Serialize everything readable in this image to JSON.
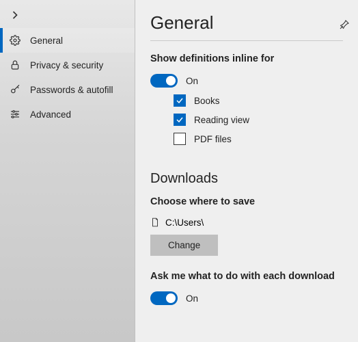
{
  "sidebar": {
    "items": [
      {
        "label": "General",
        "icon": "gear-icon",
        "selected": true
      },
      {
        "label": "Privacy & security",
        "icon": "lock-icon",
        "selected": false
      },
      {
        "label": "Passwords & autofill",
        "icon": "key-icon",
        "selected": false
      },
      {
        "label": "Advanced",
        "icon": "sliders-icon",
        "selected": false
      }
    ]
  },
  "content": {
    "title": "General",
    "definitions": {
      "heading": "Show definitions inline for",
      "toggle_state": "On",
      "options": [
        {
          "label": "Books",
          "checked": true
        },
        {
          "label": "Reading view",
          "checked": true
        },
        {
          "label": "PDF files",
          "checked": false
        }
      ]
    },
    "downloads": {
      "heading": "Downloads",
      "choose_label": "Choose where to save",
      "path": "C:\\Users\\",
      "change_button": "Change",
      "ask_heading": "Ask me what to do with each download",
      "ask_toggle_state": "On"
    }
  },
  "colors": {
    "accent": "#0067c0"
  }
}
